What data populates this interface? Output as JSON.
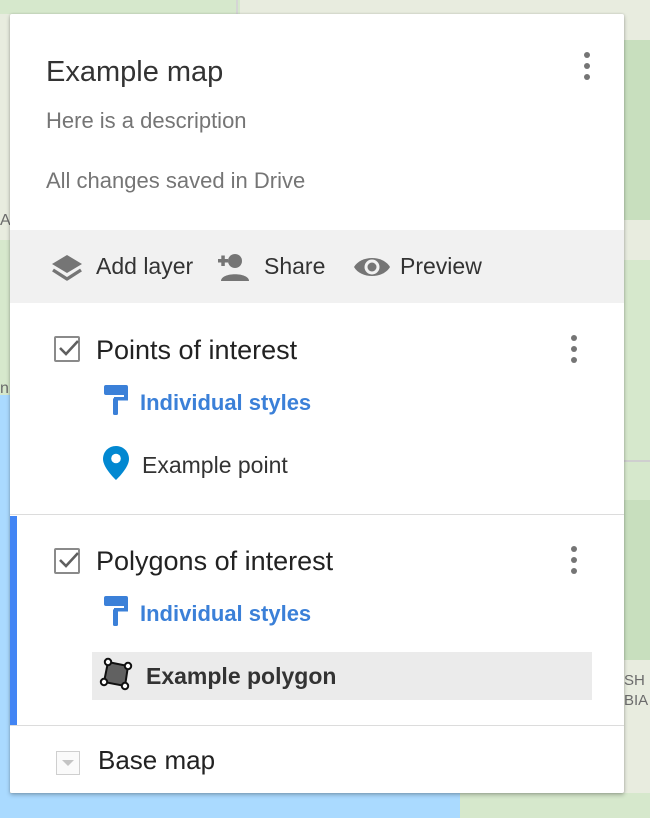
{
  "map": {
    "edge_labels": {
      "left_a": "A",
      "left_n": "n",
      "right_sh": "SH",
      "right_bia": "BIA"
    }
  },
  "panel": {
    "title": "Example map",
    "description": "Here is a description",
    "save_status": "All changes saved in Drive",
    "menu_icon": "more-vert-icon"
  },
  "toolbar": {
    "add_layer": {
      "label": "Add layer",
      "icon": "layers-icon"
    },
    "share": {
      "label": "Share",
      "icon": "person-add-icon"
    },
    "preview": {
      "label": "Preview",
      "icon": "eye-icon"
    }
  },
  "layers": [
    {
      "name": "Points of interest",
      "checked": true,
      "styles_label": "Individual styles",
      "features": [
        {
          "label": "Example point",
          "icon": "place-pin-icon",
          "selected": false
        }
      ]
    },
    {
      "name": "Polygons of interest",
      "checked": true,
      "active": true,
      "styles_label": "Individual styles",
      "features": [
        {
          "label": "Example polygon",
          "icon": "polygon-icon",
          "selected": true
        }
      ]
    }
  ],
  "base_map": {
    "label": "Base map"
  },
  "colors": {
    "accent": "#4285f4",
    "link": "#3b80d8",
    "pin": "#0288d1",
    "toolbar_bg": "#f1f1f1",
    "selected_bg": "#ebebeb"
  }
}
